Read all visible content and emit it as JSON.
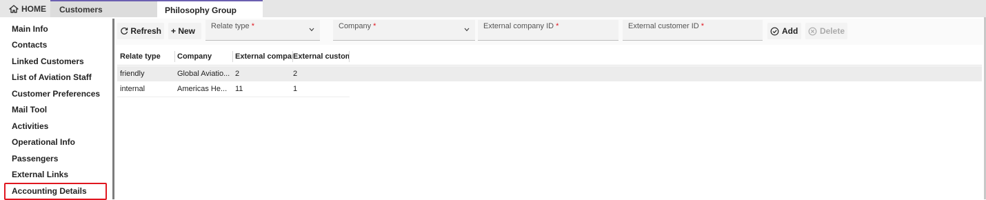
{
  "tabs": {
    "home": "HOME",
    "customers": "Customers",
    "current": "Philosophy Group"
  },
  "sidebar": {
    "items": [
      {
        "label": "Main Info"
      },
      {
        "label": "Contacts"
      },
      {
        "label": "Linked Customers"
      },
      {
        "label": "List of Aviation Staff"
      },
      {
        "label": "Customer Preferences"
      },
      {
        "label": "Mail Tool"
      },
      {
        "label": "Activities"
      },
      {
        "label": "Operational Info"
      },
      {
        "label": "Passengers"
      },
      {
        "label": "External Links",
        "selected": true
      },
      {
        "label": "Accounting Details"
      }
    ]
  },
  "toolbar": {
    "refresh_label": "Refresh",
    "new_label": "+ New",
    "add_label": "Add",
    "delete_label": "Delete"
  },
  "fields": {
    "relate_type": {
      "label": "Relate type",
      "required": "*",
      "value": ""
    },
    "company": {
      "label": "Company",
      "required": "*",
      "value": ""
    },
    "external_company_id": {
      "label": "External company ID",
      "required": "*",
      "value": ""
    },
    "external_customer_id": {
      "label": "External customer ID",
      "required": "*",
      "value": ""
    }
  },
  "table": {
    "columns": [
      "Relate type",
      "Company",
      "External company",
      "External customei"
    ],
    "rows": [
      [
        "friendly",
        "Global Aviatio...",
        "2",
        "2"
      ],
      [
        "internal",
        "Americas He...",
        "11",
        "1"
      ]
    ]
  },
  "colors": {
    "accent": "#6b5fb0",
    "selection_border": "#e0161f",
    "required": "#e0161f"
  }
}
